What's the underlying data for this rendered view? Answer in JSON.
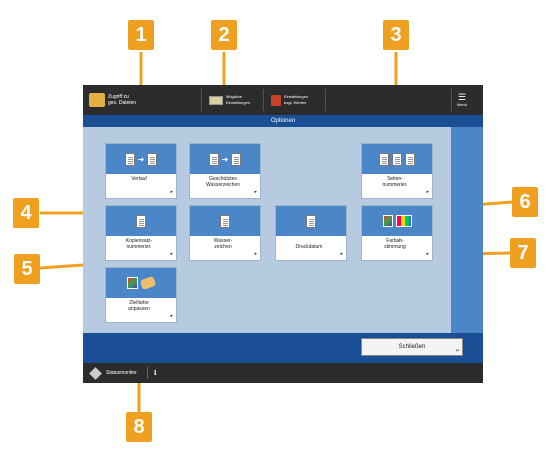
{
  "topbar": {
    "left_line1": "Zugriff zu",
    "left_line2": "ges. Dateien",
    "mid1_line1": "Mögliche",
    "mid1_line2": "Einstellungen",
    "mid2_line1": "Einstellungen",
    "mid2_line2": "bzgl. Werten",
    "menu_label": "Menü"
  },
  "title": "Optionen",
  "buttons": [
    {
      "label_line1": "Verlauf",
      "label_line2": ""
    },
    {
      "label_line1": "Geschütztes",
      "label_line2": "Wasserzeichen"
    },
    {
      "label_line1": "Seiten-",
      "label_line2": "nummerier."
    },
    {
      "label_line1": "Kopiensatz-",
      "label_line2": "nummerier."
    },
    {
      "label_line1": "Wasser-",
      "label_line2": "zeichen"
    },
    {
      "label_line1": "Druckdatum",
      "label_line2": ""
    },
    {
      "label_line1": "Farbab-",
      "label_line2": "stimmung"
    },
    {
      "label_line1": "Zielfarbe",
      "label_line2": "anpassen"
    }
  ],
  "close_label": "Schließen",
  "statusbar_label": "Statusmonitor",
  "callouts": [
    "1",
    "2",
    "3",
    "4",
    "5",
    "6",
    "7",
    "8"
  ],
  "colors": {
    "accent": "#f0a020",
    "blue": "#1a4f96",
    "tile": "#4a86c8"
  }
}
